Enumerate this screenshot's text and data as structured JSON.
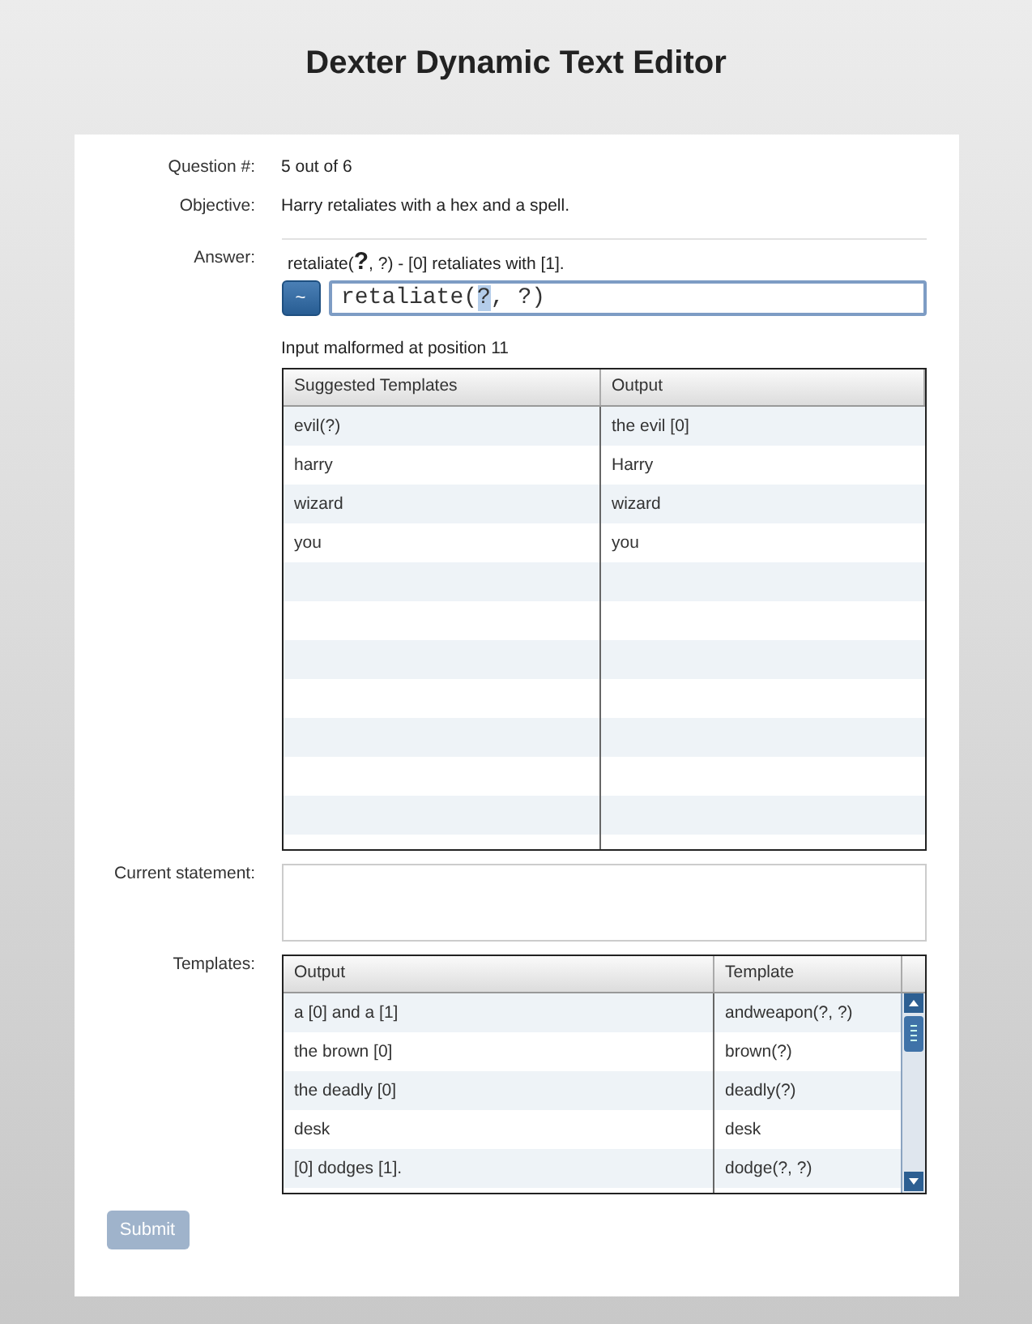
{
  "title": "Dexter Dynamic Text Editor",
  "fields": [
    {
      "label": "Question #:",
      "value": "5 out of 6"
    },
    {
      "label": "Objective:",
      "value": "Harry retaliates with a hex and a spell."
    }
  ],
  "answer": {
    "label": "Answer:",
    "hint": "retaliate(**?**, ?) - [0] retaliates with [1].",
    "button": "~",
    "value_before": "retaliate(",
    "selected_text": "?",
    "value_after": ", ?)",
    "error": "Input malformed at position 11"
  },
  "suggested": {
    "columns": [
      "Suggested Templates",
      "Output"
    ],
    "rows": [
      [
        "evil(?)",
        "the evil [0]"
      ],
      [
        "harry",
        "Harry"
      ],
      [
        "wizard",
        "wizard"
      ],
      [
        "you",
        "you"
      ]
    ]
  },
  "current_statement": {
    "label": "Current statement:"
  },
  "templates": {
    "label": "Templates:",
    "columns": [
      "Output",
      "Template"
    ],
    "rows": [
      [
        "a [0] and a [1]",
        "andweapon(?, ?)"
      ],
      [
        "the brown [0]",
        "brown(?)"
      ],
      [
        "the deadly [0]",
        "deadly(?)"
      ],
      [
        "desk",
        "desk"
      ],
      [
        "[0] dodges [1].",
        "dodge(?, ?)"
      ]
    ]
  },
  "submit": {
    "label": "Submit",
    "disabled": true
  }
}
